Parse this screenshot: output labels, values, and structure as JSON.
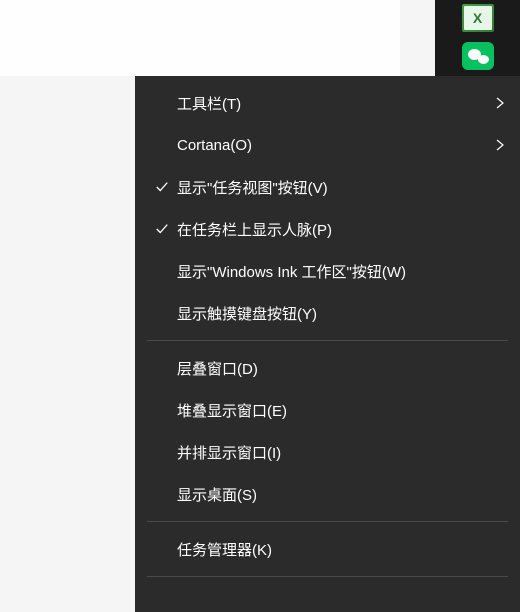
{
  "desktop_icons": {
    "excel": "Excel",
    "wechat": "WeChat"
  },
  "menu": {
    "sections": [
      {
        "items": [
          {
            "label": "工具栏(T)",
            "checked": false,
            "hasSubmenu": true
          },
          {
            "label": "Cortana(O)",
            "checked": false,
            "hasSubmenu": true
          },
          {
            "label": "显示\"任务视图\"按钮(V)",
            "checked": true,
            "hasSubmenu": false
          },
          {
            "label": "在任务栏上显示人脉(P)",
            "checked": true,
            "hasSubmenu": false
          },
          {
            "label": "显示\"Windows Ink 工作区\"按钮(W)",
            "checked": false,
            "hasSubmenu": false
          },
          {
            "label": "显示触摸键盘按钮(Y)",
            "checked": false,
            "hasSubmenu": false
          }
        ]
      },
      {
        "items": [
          {
            "label": "层叠窗口(D)",
            "checked": false,
            "hasSubmenu": false
          },
          {
            "label": "堆叠显示窗口(E)",
            "checked": false,
            "hasSubmenu": false
          },
          {
            "label": "并排显示窗口(I)",
            "checked": false,
            "hasSubmenu": false
          },
          {
            "label": "显示桌面(S)",
            "checked": false,
            "hasSubmenu": false
          }
        ]
      },
      {
        "items": [
          {
            "label": "任务管理器(K)",
            "checked": false,
            "hasSubmenu": false
          }
        ]
      }
    ]
  }
}
